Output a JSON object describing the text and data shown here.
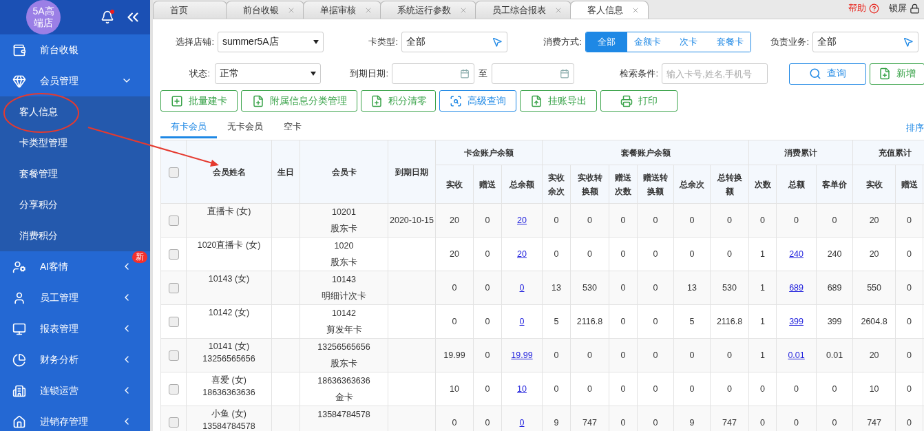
{
  "sidebar": {
    "logo": "5A高端店",
    "has_notification": true,
    "menu": [
      {
        "label": "前台收银"
      },
      {
        "label": "会员管理",
        "expanded": true,
        "children": [
          {
            "label": "客人信息"
          },
          {
            "label": "卡类型管理"
          },
          {
            "label": "套餐管理"
          },
          {
            "label": "分享积分"
          },
          {
            "label": "消费积分"
          }
        ]
      },
      {
        "label": "AI客情",
        "expanded": false,
        "badge": "新"
      },
      {
        "label": "员工管理",
        "expanded": false
      },
      {
        "label": "报表管理",
        "expanded": false
      },
      {
        "label": "财务分析",
        "expanded": false
      },
      {
        "label": "连锁运营",
        "expanded": false
      },
      {
        "label": "进销存管理",
        "expanded": false
      }
    ]
  },
  "tabs": [
    {
      "label": "首页",
      "closable": false,
      "selected": false
    },
    {
      "label": "前台收银",
      "closable": true,
      "selected": false
    },
    {
      "label": "单据审核",
      "closable": true,
      "selected": false
    },
    {
      "label": "系统运行参数",
      "closable": true,
      "selected": false
    },
    {
      "label": "员工综合报表",
      "closable": true,
      "selected": false
    },
    {
      "label": "客人信息",
      "closable": true,
      "selected": true
    }
  ],
  "header_links": {
    "help": "帮助",
    "lock": "锁屏"
  },
  "filters": {
    "store": {
      "label": "选择店铺:",
      "value": "summer5A店"
    },
    "card_type": {
      "label": "卡类型:",
      "value": "全部"
    },
    "pay_mode": {
      "label": "消费方式:",
      "options": [
        {
          "label": "全部",
          "selected": true
        },
        {
          "label": "金额卡",
          "selected": false
        },
        {
          "label": "次卡",
          "selected": false
        },
        {
          "label": "套餐卡",
          "selected": false
        }
      ]
    },
    "business": {
      "label": "负责业务:",
      "value": "全部"
    },
    "status": {
      "label": "状态:",
      "value": "正常"
    },
    "expiry": {
      "label": "到期日期:",
      "separator": "至"
    },
    "search": {
      "label": "检索条件:",
      "placeholder": "输入卡号,姓名,手机号"
    },
    "query_button": "查询",
    "add_button": "新增"
  },
  "actions": [
    {
      "label": "批量建卡",
      "kind": "square-plus"
    },
    {
      "label": "附属信息分类管理",
      "kind": "file-plus"
    },
    {
      "label": "积分清零",
      "kind": "file-plus"
    },
    {
      "label": "高级查询",
      "kind": "search"
    },
    {
      "label": "挂账导出",
      "kind": "upload"
    },
    {
      "label": "打印",
      "kind": "print"
    }
  ],
  "member_tabs": [
    {
      "label": "有卡会员",
      "selected": true
    },
    {
      "label": "无卡会员",
      "selected": false
    },
    {
      "label": "空卡",
      "selected": false
    }
  ],
  "sort_link": "排序",
  "table": {
    "select_all_checked": false,
    "columns": [
      "会员姓名",
      "生日",
      "会员卡",
      "到期日期"
    ],
    "groups": [
      {
        "label": "卡金账户余额",
        "columns": [
          "实收",
          "赠送",
          "总余额"
        ]
      },
      {
        "label": "套餐账户余额",
        "columns": [
          "实收余次",
          "实收转换额",
          "赠送次数",
          "赠送转换额",
          "总余次",
          "总转换额"
        ]
      },
      {
        "label": "消费累计",
        "columns": [
          "次数",
          "总额",
          "客单价"
        ]
      },
      {
        "label": "充值累计",
        "columns": [
          "实收",
          "赠送"
        ]
      }
    ],
    "rows": [
      {
        "checked": false,
        "name": "直播卡 (女)",
        "card_no": "10201",
        "card_type": "股东卡",
        "expiry": "2020-10-15",
        "cells": [
          {
            "text": "20",
            "link": false
          },
          {
            "text": "0",
            "link": false
          },
          {
            "text": "20",
            "link": true
          },
          {
            "text": "0",
            "link": false
          },
          {
            "text": "0",
            "link": false
          },
          {
            "text": "0",
            "link": false
          },
          {
            "text": "0",
            "link": false
          },
          {
            "text": "0",
            "link": false
          },
          {
            "text": "0",
            "link": false
          },
          {
            "text": "0",
            "link": false
          },
          {
            "text": "0",
            "link": false
          },
          {
            "text": "0",
            "link": false
          },
          {
            "text": "20",
            "link": false
          },
          {
            "text": "0",
            "link": false
          }
        ]
      },
      {
        "checked": false,
        "name": "1020直播卡 (女)",
        "card_no": "1020",
        "card_type": "股东卡",
        "cells": [
          {
            "text": "20",
            "link": false
          },
          {
            "text": "0",
            "link": false
          },
          {
            "text": "20",
            "link": true
          },
          {
            "text": "0",
            "link": false
          },
          {
            "text": "0",
            "link": false
          },
          {
            "text": "0",
            "link": false
          },
          {
            "text": "0",
            "link": false
          },
          {
            "text": "0",
            "link": false
          },
          {
            "text": "0",
            "link": false
          },
          {
            "text": "1",
            "link": false
          },
          {
            "text": "240",
            "link": true
          },
          {
            "text": "240",
            "link": false
          },
          {
            "text": "20",
            "link": false
          },
          {
            "text": "0",
            "link": false
          }
        ]
      },
      {
        "checked": false,
        "name": "10143 (女)",
        "card_no": "10143",
        "card_type": "明细计次卡",
        "cells": [
          {
            "text": "0",
            "link": false
          },
          {
            "text": "0",
            "link": false
          },
          {
            "text": "0",
            "link": true
          },
          {
            "text": "13",
            "link": false
          },
          {
            "text": "530",
            "link": false
          },
          {
            "text": "0",
            "link": false
          },
          {
            "text": "0",
            "link": false
          },
          {
            "text": "13",
            "link": false
          },
          {
            "text": "530",
            "link": false
          },
          {
            "text": "1",
            "link": false
          },
          {
            "text": "689",
            "link": true
          },
          {
            "text": "689",
            "link": false
          },
          {
            "text": "550",
            "link": false
          },
          {
            "text": "0",
            "link": false
          }
        ]
      },
      {
        "checked": false,
        "name": "10142 (女)",
        "card_no": "10142",
        "card_type": "剪发年卡",
        "cells": [
          {
            "text": "0",
            "link": false
          },
          {
            "text": "0",
            "link": false
          },
          {
            "text": "0",
            "link": true
          },
          {
            "text": "5",
            "link": false
          },
          {
            "text": "2116.8",
            "link": false
          },
          {
            "text": "0",
            "link": false
          },
          {
            "text": "0",
            "link": false
          },
          {
            "text": "5",
            "link": false
          },
          {
            "text": "2116.8",
            "link": false
          },
          {
            "text": "1",
            "link": false
          },
          {
            "text": "399",
            "link": true
          },
          {
            "text": "399",
            "link": false
          },
          {
            "text": "2604.8",
            "link": false
          },
          {
            "text": "0",
            "link": false
          }
        ]
      },
      {
        "checked": false,
        "name": "10141 (女)",
        "phone": "13256565656",
        "card_no": "13256565656",
        "card_type": "股东卡",
        "cells": [
          {
            "text": "19.99",
            "link": false
          },
          {
            "text": "0",
            "link": false
          },
          {
            "text": "19.99",
            "link": true
          },
          {
            "text": "0",
            "link": false
          },
          {
            "text": "0",
            "link": false
          },
          {
            "text": "0",
            "link": false
          },
          {
            "text": "0",
            "link": false
          },
          {
            "text": "0",
            "link": false
          },
          {
            "text": "0",
            "link": false
          },
          {
            "text": "1",
            "link": false
          },
          {
            "text": "0.01",
            "link": true
          },
          {
            "text": "0.01",
            "link": false
          },
          {
            "text": "20",
            "link": false
          },
          {
            "text": "0",
            "link": false
          }
        ]
      },
      {
        "checked": false,
        "name": "喜爱 (女)",
        "phone": "18636363636",
        "card_no": "18636363636",
        "card_type": "金卡",
        "cells": [
          {
            "text": "10",
            "link": false
          },
          {
            "text": "0",
            "link": false
          },
          {
            "text": "10",
            "link": true
          },
          {
            "text": "0",
            "link": false
          },
          {
            "text": "0",
            "link": false
          },
          {
            "text": "0",
            "link": false
          },
          {
            "text": "0",
            "link": false
          },
          {
            "text": "0",
            "link": false
          },
          {
            "text": "0",
            "link": false
          },
          {
            "text": "0",
            "link": false
          },
          {
            "text": "0",
            "link": false
          },
          {
            "text": "0",
            "link": false
          },
          {
            "text": "10",
            "link": false
          },
          {
            "text": "0",
            "link": false
          }
        ]
      },
      {
        "checked": false,
        "name": "小鱼 (女)",
        "phone": "13584784578",
        "card_no": "13584784578",
        "cells": [
          {
            "text": "0",
            "link": false
          },
          {
            "text": "0",
            "link": false
          },
          {
            "text": "0",
            "link": true
          },
          {
            "text": "9",
            "link": false
          },
          {
            "text": "747",
            "link": false
          },
          {
            "text": "0",
            "link": false
          },
          {
            "text": "0",
            "link": false
          },
          {
            "text": "9",
            "link": false
          },
          {
            "text": "747",
            "link": false
          },
          {
            "text": "0",
            "link": false
          },
          {
            "text": "0",
            "link": false
          },
          {
            "text": "0",
            "link": false
          },
          {
            "text": "747",
            "link": false
          },
          {
            "text": "0",
            "link": false
          }
        ]
      }
    ]
  }
}
